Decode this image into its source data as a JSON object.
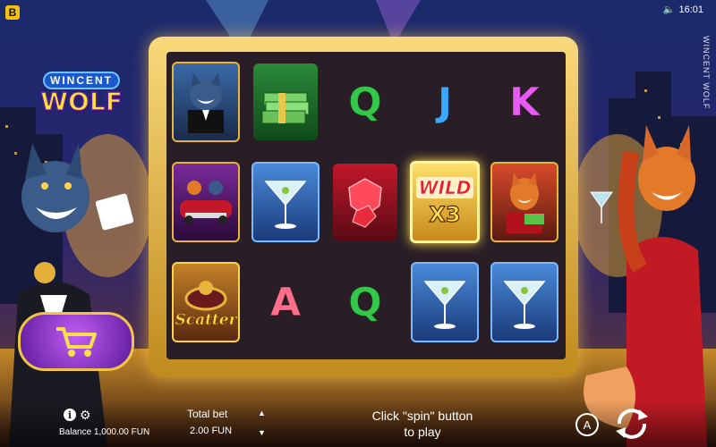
{
  "app": {
    "brand_badge": "B",
    "time": "16:01",
    "game_title_vertical": "WINCENT WOLF"
  },
  "logo": {
    "line1": "WINCENT",
    "line2": "WOLF"
  },
  "reels": [
    [
      {
        "symbol": "wolf-card"
      },
      {
        "symbol": "car-wild"
      },
      {
        "symbol": "scatter",
        "text": "Scatter"
      }
    ],
    [
      {
        "symbol": "cash-stack"
      },
      {
        "symbol": "martini"
      },
      {
        "symbol": "letter",
        "text": "A",
        "color": "#ff6f8a"
      }
    ],
    [
      {
        "symbol": "letter",
        "text": "Q",
        "color": "#34c84a"
      },
      {
        "symbol": "ruby"
      },
      {
        "symbol": "letter",
        "text": "Q",
        "color": "#34c84a"
      }
    ],
    [
      {
        "symbol": "letter",
        "text": "J",
        "color": "#3aa8ff"
      },
      {
        "symbol": "wild-x3",
        "text": "WILD",
        "multiplier": "X3"
      },
      {
        "symbol": "martini"
      }
    ],
    [
      {
        "symbol": "letter",
        "text": "K",
        "color": "#e65bf0"
      },
      {
        "symbol": "fox-card"
      },
      {
        "symbol": "martini"
      }
    ]
  ],
  "controls": {
    "balance_label": "Balance 1,000.00 FUN",
    "total_bet_label": "Total bet",
    "total_bet_value": "2.00 FUN",
    "spin_prompt_line1": "Click \"spin\" button",
    "spin_prompt_line2": "to play",
    "auto_label": "A"
  },
  "colors": {
    "accent_gold": "#f0c545",
    "buy_purple": "#7d2bc4",
    "frame_dark": "#2a1e26"
  }
}
